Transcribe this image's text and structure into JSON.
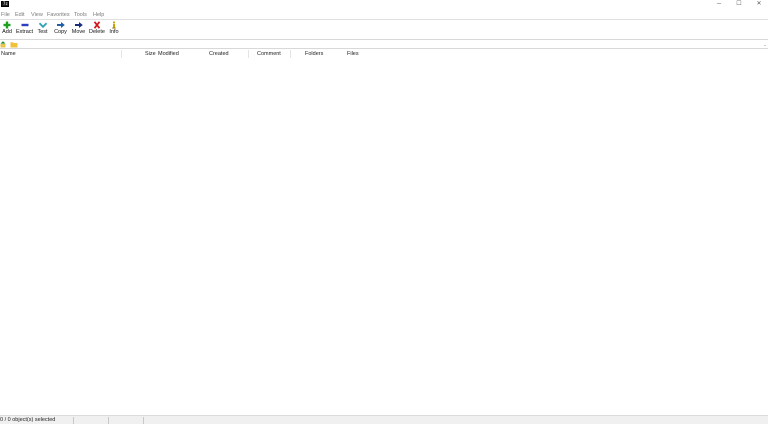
{
  "titlebar": {
    "app_icon_text": "7z",
    "minimize_glyph": "─",
    "maximize_glyph": "☐",
    "close_glyph": "✕"
  },
  "menu": {
    "items": [
      "File",
      "Edit",
      "View",
      "Favorites",
      "Tools",
      "Help"
    ]
  },
  "toolbar": {
    "buttons": [
      {
        "label": "Add",
        "icon": "plus-icon",
        "color": "#1fa01f"
      },
      {
        "label": "Extract",
        "icon": "minus-icon",
        "color": "#2a3fbf"
      },
      {
        "label": "Test",
        "icon": "check-icon",
        "color": "#2aa3b5"
      },
      {
        "label": "Copy",
        "icon": "copy-arrow-icon",
        "color": "#1f5fa8"
      },
      {
        "label": "Move",
        "icon": "move-arrow-icon",
        "color": "#1a2d7a"
      },
      {
        "label": "Delete",
        "icon": "delete-x-icon",
        "color": "#d01818"
      },
      {
        "label": "Info",
        "icon": "info-icon",
        "color": "#c9a400"
      }
    ]
  },
  "address": {
    "value": "",
    "up_icon": "up-folder-icon",
    "folder_icon": "folder-icon",
    "dropdown_glyph": "⌄"
  },
  "columns": [
    "Name",
    "Size",
    "Modified",
    "Created",
    "Comment",
    "Folders",
    "Files"
  ],
  "status": {
    "text": "0 / 0 object(s) selected"
  }
}
